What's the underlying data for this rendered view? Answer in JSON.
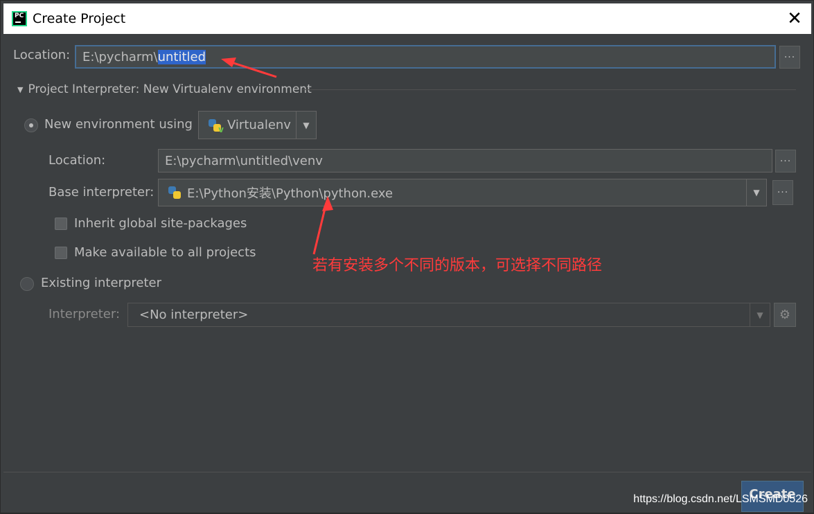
{
  "window": {
    "title": "Create Project",
    "close_glyph": "✕"
  },
  "project": {
    "location_label": "Location:",
    "location_prefix": "E:\\pycharm\\",
    "location_selected": "untitled",
    "browse_glyph": "···"
  },
  "interpreter_section": {
    "header": "Project Interpreter: New Virtualenv environment",
    "new_env_label": "New environment using",
    "env_tool": "Virtualenv",
    "venv_location_label": "Location:",
    "venv_location_value": "E:\\pycharm\\untitled\\venv",
    "base_interpreter_label": "Base interpreter:",
    "base_interpreter_value": "E:\\Python安装\\Python\\python.exe",
    "inherit_label": "Inherit global site-packages",
    "make_available_label": "Make available to all projects",
    "existing_label": "Existing interpreter",
    "interpreter_label": "Interpreter:",
    "interpreter_value": "<No interpreter>"
  },
  "footer": {
    "create_label": "Create"
  },
  "annotation": {
    "text": "若有安装多个不同的版本，可选择不同路径",
    "color": "#ff3b3b"
  },
  "watermark": "https://blog.csdn.net/LSMSMD0526",
  "icons": {
    "app": "pycharm-icon",
    "python": "python-icon",
    "settings": "gear-icon"
  }
}
